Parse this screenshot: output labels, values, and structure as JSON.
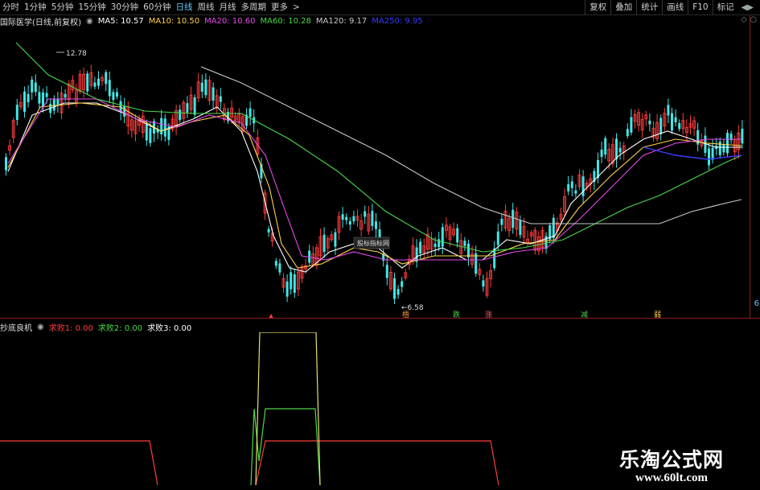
{
  "toolbar": {
    "tabs": [
      "分时",
      "1分钟",
      "5分钟",
      "15分钟",
      "30分钟",
      "60分钟",
      "日线",
      "周线",
      "月线",
      "多周期",
      "更多"
    ],
    "active_tab": "日线",
    "buttons": [
      "复权",
      "叠加",
      "统计",
      "画线",
      "F10",
      "标记"
    ]
  },
  "main_chart": {
    "stock_label": "国际医学(日线,前复权)",
    "ma": [
      {
        "label": "MA5: 10.57",
        "color": "#ffffff"
      },
      {
        "label": "MA10: 10.50",
        "color": "#ffd24a"
      },
      {
        "label": "MA20: 10.60",
        "color": "#e84ae8"
      },
      {
        "label": "MA60: 10.28",
        "color": "#4ad84a"
      },
      {
        "label": "MA120: 9.17",
        "color": "#c8c8c8"
      },
      {
        "label": "MA250: 9.95",
        "color": "#3a3aff"
      }
    ],
    "high_label": "12.78",
    "low_label": "6.58",
    "center_badge": "股标指标网",
    "right_axis_mark": "6",
    "markers": [
      {
        "text": "梧",
        "color": "#ff9a3c"
      },
      {
        "text": "跌",
        "color": "#4ad84a"
      },
      {
        "text": "涨",
        "color": "#ff5a5a"
      },
      {
        "text": "减",
        "color": "#4ad84a"
      },
      {
        "text": "弱",
        "color": "#ffcc33"
      }
    ],
    "colors": {
      "up": "#ff3c3c",
      "down": "#42e6e6"
    }
  },
  "sub_chart": {
    "indicator_name": "抄底良机",
    "lines": [
      {
        "label": "求败1: 0.00",
        "color": "#ff3c3c"
      },
      {
        "label": "求败2: 0.00",
        "color": "#4ad84a"
      },
      {
        "label": "求败3: 0.00",
        "color": "#ffffff"
      }
    ]
  },
  "watermark": {
    "title": "乐淘公式网",
    "url": "www.60lt.com"
  }
}
